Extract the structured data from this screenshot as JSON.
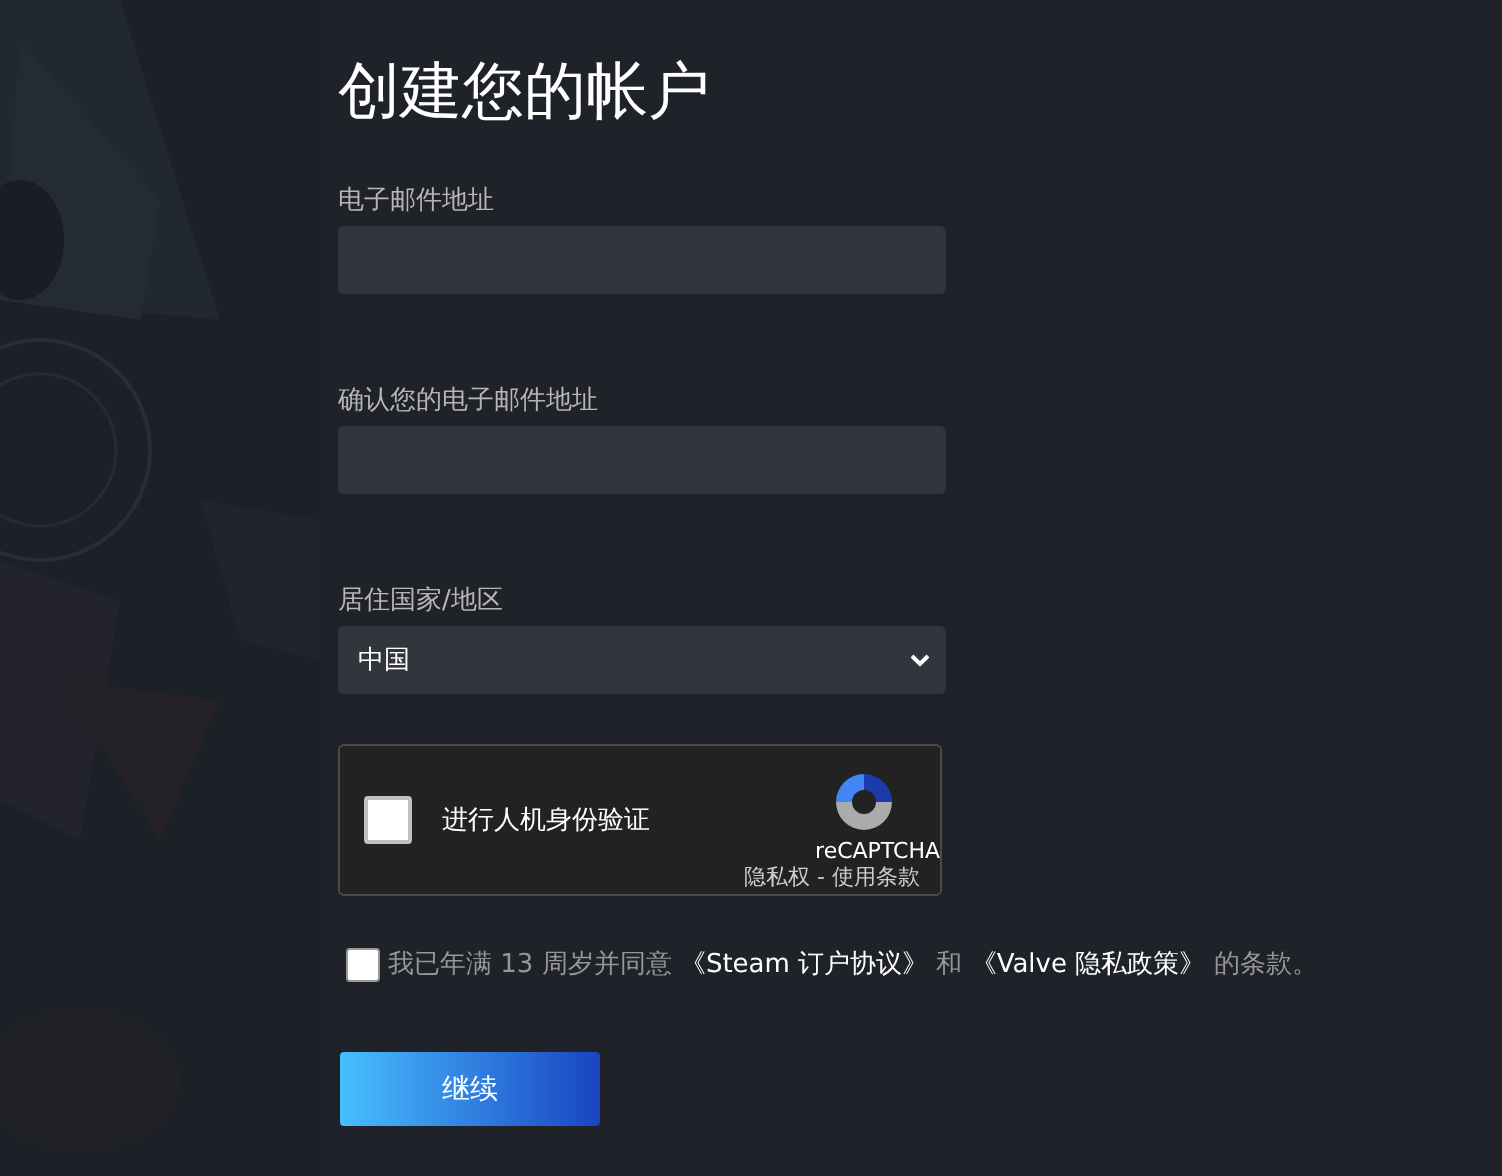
{
  "title": "创建您的帐户",
  "fields": [
    {
      "kind": "input",
      "label": "电子邮件地址"
    },
    {
      "kind": "input",
      "label": "确认您的电子邮件地址"
    },
    {
      "kind": "select",
      "label": "居住国家/地区",
      "value": "中国"
    }
  ],
  "captcha": {
    "checked": false,
    "label": "进行人机身份验证",
    "brand": "reCAPTCHA",
    "links": "隐私权 - 使用条款"
  },
  "agreement": {
    "checked": false,
    "parts": [
      {
        "kind": "text",
        "text": "我已年满 13 周岁并同意 "
      },
      {
        "kind": "link",
        "text": "《Steam 订户协议》"
      },
      {
        "kind": "text",
        "text": " 和 "
      },
      {
        "kind": "link",
        "text": "《Valve 隐私政策》"
      },
      {
        "kind": "text",
        "text": " 的条款。"
      }
    ]
  },
  "button": "继续"
}
